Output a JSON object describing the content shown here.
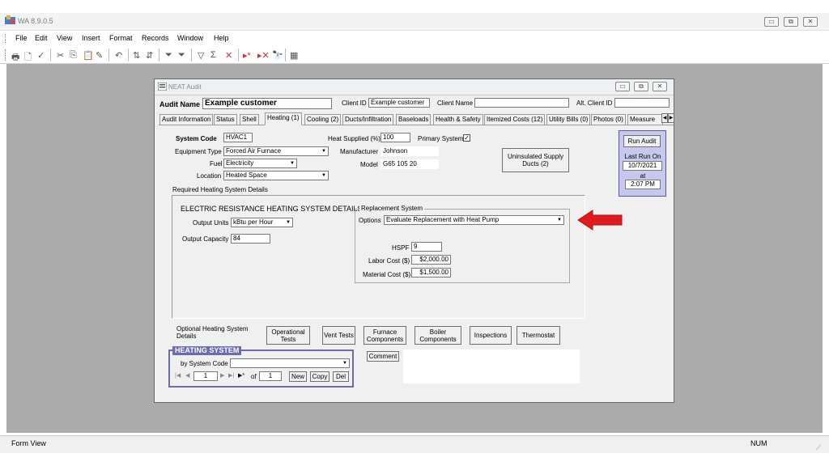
{
  "app": {
    "title": "WA 8.9.0.5",
    "menus": [
      "File",
      "Edit",
      "View",
      "Insert",
      "Format",
      "Records",
      "Window",
      "Help"
    ],
    "status_left": "Form View",
    "status_right": "NUM"
  },
  "form": {
    "title": "NEAT Audit",
    "audit_name_label": "Audit Name",
    "audit_name_value": "Example customer",
    "client_id_label": "Client ID",
    "client_id_value": "Example customer",
    "client_name_label": "Client Name",
    "client_name_value": "",
    "alt_client_id_label": "Alt. Client ID",
    "alt_client_id_value": "",
    "tabs": [
      "Audit Information",
      "Status",
      "Shell",
      "Heating (1)",
      "Cooling (2)",
      "Ducts/Infiltration",
      "Baseloads",
      "Health & Safety",
      "Itemized Costs (12)",
      "Utility Bills (0)",
      "Photos (0)",
      "Measure"
    ],
    "active_tab": "Heating (1)"
  },
  "heating": {
    "system_code_label": "System Code",
    "system_code_value": "HVAC1",
    "equipment_type_label": "Equipment Type",
    "equipment_type_value": "Forced Air Furnace",
    "fuel_label": "Fuel",
    "fuel_value": "Electricity",
    "location_label": "Location",
    "location_value": "Heated Space",
    "heat_supplied_label": "Heat Supplied (%)",
    "heat_supplied_value": "100",
    "primary_system_label": "Primary System",
    "primary_system_checked": true,
    "manufacturer_label": "Manufacturer",
    "manufacturer_value": "Johnson",
    "model_label": "Model",
    "model_value": "G65 105 20",
    "uninsulated_button": "Uninsulated Supply Ducts (2)",
    "required_details_label": "Required Heating System Details",
    "section_title": "ELECTRIC RESISTANCE HEATING SYSTEM DETAILS",
    "output_units_label": "Output Units",
    "output_units_value": "kBtu per Hour",
    "output_capacity_label": "Output Capacity",
    "output_capacity_value": "84",
    "replacement": {
      "group_label": "Replacement System",
      "options_label": "Options",
      "options_value": "Evaluate Replacement with Heat Pump",
      "hspf_label": "HSPF",
      "hspf_value": "9",
      "labor_cost_label": "Labor Cost ($)",
      "labor_cost_value": "$2,000.00",
      "material_cost_label": "Material Cost ($)",
      "material_cost_value": "$1,500.00"
    },
    "optional_label": "Optional Heating System Details",
    "optional_buttons": [
      "Operational Tests",
      "Vent Tests",
      "Furnace Components",
      "Boiler Components",
      "Inspections",
      "Thermostat"
    ],
    "comment_button": "Comment"
  },
  "run_audit": {
    "button": "Run Audit",
    "last_run_label": "Last Run On",
    "date": "10/7/2021",
    "at_label": "at",
    "time": "2:07 PM"
  },
  "nav": {
    "group_title": "HEATING SYSTEM",
    "by_label": "by System Code",
    "by_value": "",
    "record_number": "1",
    "of_label": "of",
    "record_total": "1",
    "new_button": "New",
    "copy_button": "Copy",
    "del_button": "Del"
  },
  "colors": {
    "workspace": "#ababab",
    "run_audit_panel": "#c8c8ef",
    "nav_header": "#6b6bb5",
    "arrow": "#e11b1b"
  }
}
